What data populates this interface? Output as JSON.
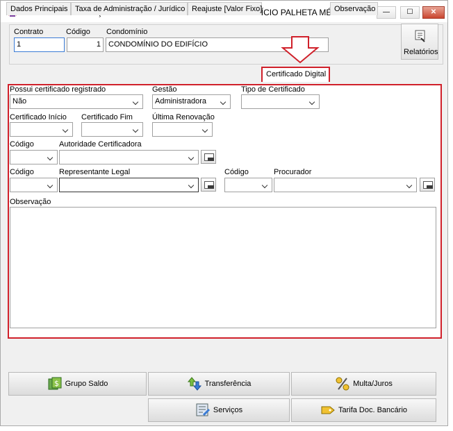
{
  "window": {
    "title": "Contrato Administração / Condomínio : CONDOMÍNIO DO EDIFÍCIO PALHETA MÉIER",
    "minimize": "—",
    "maximize": "☐",
    "close": "✕"
  },
  "header": {
    "contrato_label": "Contrato",
    "contrato_value": "1",
    "codigo_label": "Código",
    "codigo_value": "1",
    "condominio_label": "Condomínio",
    "condominio_value": "CONDOMÍNIO DO EDIFÍCIO",
    "relatorios_label": "Relatórios"
  },
  "tabs": [
    {
      "label": "Dados Principais"
    },
    {
      "label": "Taxa de Administração / Jurídico"
    },
    {
      "label": "Reajuste [Valor Fixo]"
    },
    {
      "label": "Certificado Digital"
    },
    {
      "label": "Observação"
    }
  ],
  "form": {
    "possui_label": "Possui certificado registrado",
    "possui_value": "Não",
    "gestao_label": "Gestão",
    "gestao_value": "Administradora",
    "tipo_label": "Tipo de Certificado",
    "tipo_value": "",
    "inicio_label": "Certificado Início",
    "fim_label": "Certificado Fim",
    "renovacao_label": "Última Renovação",
    "codigo1_label": "Código",
    "autoridade_label": "Autoridade Certificadora",
    "codigo2_label": "Código",
    "representante_label": "Representante Legal",
    "codigo3_label": "Código",
    "procurador_label": "Procurador",
    "observacao_label": "Observação"
  },
  "buttons": {
    "grupo_saldo": "Grupo Saldo",
    "transferencia": "Transferência",
    "multa_juros": "Multa/Juros",
    "servicos": "Serviços",
    "tarifa": "Tarifa Doc. Bancário"
  }
}
